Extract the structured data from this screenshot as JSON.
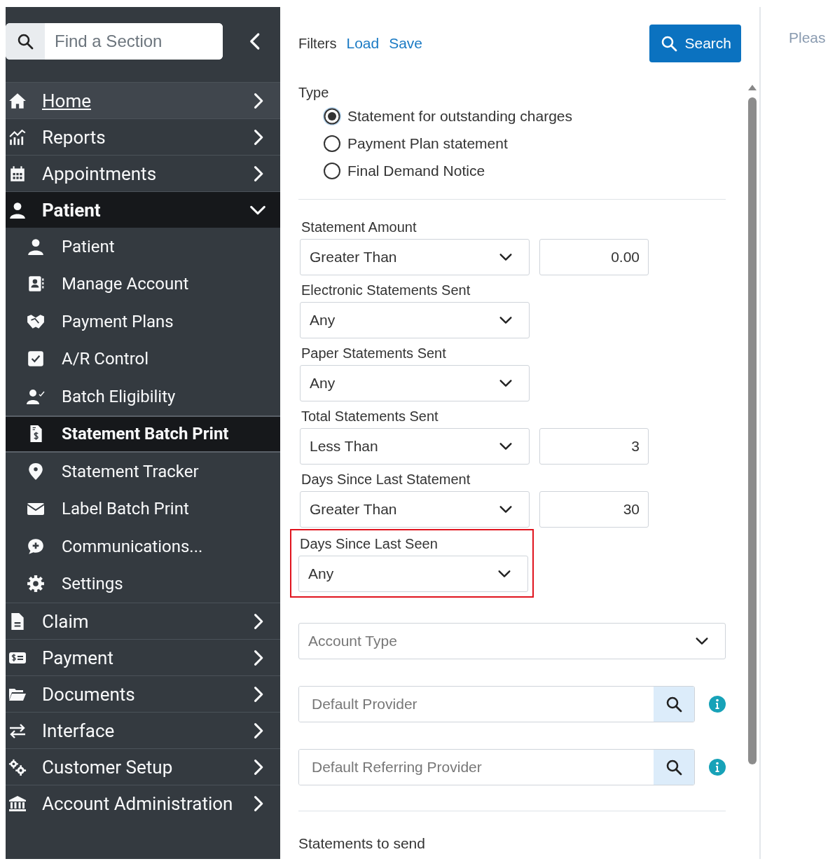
{
  "sidebar": {
    "search": {
      "placeholder": "Find a Section"
    },
    "items": [
      {
        "label": "Home",
        "hovered": true,
        "expanded": false
      },
      {
        "label": "Reports",
        "hovered": false,
        "expanded": false
      },
      {
        "label": "Appointments",
        "hovered": false,
        "expanded": false
      },
      {
        "label": "Patient",
        "hovered": false,
        "expanded": true,
        "children": [
          {
            "label": "Patient",
            "selected": false
          },
          {
            "label": "Manage Account",
            "selected": false
          },
          {
            "label": "Payment Plans",
            "selected": false
          },
          {
            "label": "A/R Control",
            "selected": false
          },
          {
            "label": "Batch Eligibility",
            "selected": false
          },
          {
            "label": "Statement Batch Print",
            "selected": true
          },
          {
            "label": "Statement Tracker",
            "selected": false
          },
          {
            "label": "Label Batch Print",
            "selected": false
          },
          {
            "label": "Communications...",
            "selected": false
          },
          {
            "label": "Settings",
            "selected": false
          }
        ]
      },
      {
        "label": "Claim",
        "hovered": false,
        "expanded": false
      },
      {
        "label": "Payment",
        "hovered": false,
        "expanded": false
      },
      {
        "label": "Documents",
        "hovered": false,
        "expanded": false
      },
      {
        "label": "Interface",
        "hovered": false,
        "expanded": false
      },
      {
        "label": "Customer Setup",
        "hovered": false,
        "expanded": false
      },
      {
        "label": "Account Administration",
        "hovered": false,
        "expanded": false
      }
    ]
  },
  "filters": {
    "title": "Filters",
    "links": [
      "Load",
      "Save"
    ],
    "search_button": "Search",
    "type": {
      "label": "Type",
      "options": [
        {
          "label": "Statement for outstanding charges",
          "selected": true
        },
        {
          "label": "Payment Plan statement",
          "selected": false
        },
        {
          "label": "Final Demand Notice",
          "selected": false
        }
      ]
    },
    "criteria": [
      {
        "kind": "select_number",
        "label": "Statement Amount",
        "value": "Greater Than",
        "number": "0.00",
        "highlighted": false
      },
      {
        "kind": "select",
        "label": "Electronic Statements Sent",
        "value": "Any",
        "highlighted": false
      },
      {
        "kind": "select",
        "label": "Paper Statements Sent",
        "value": "Any",
        "highlighted": false
      },
      {
        "kind": "select_number",
        "label": "Total Statements Sent",
        "value": "Less Than",
        "number": "3",
        "highlighted": false
      },
      {
        "kind": "select_number",
        "label": "Days Since Last Statement",
        "value": "Greater Than",
        "number": "30",
        "highlighted": false
      },
      {
        "kind": "select",
        "label": "Days Since Last Seen",
        "value": "Any",
        "highlighted": true
      }
    ],
    "account_type": {
      "placeholder": "Account Type"
    },
    "lookups": [
      {
        "placeholder": "Default Provider"
      },
      {
        "placeholder": "Default Referring Provider"
      }
    ],
    "section_title": "Statements to send"
  },
  "details": {
    "message": "Pleas"
  }
}
